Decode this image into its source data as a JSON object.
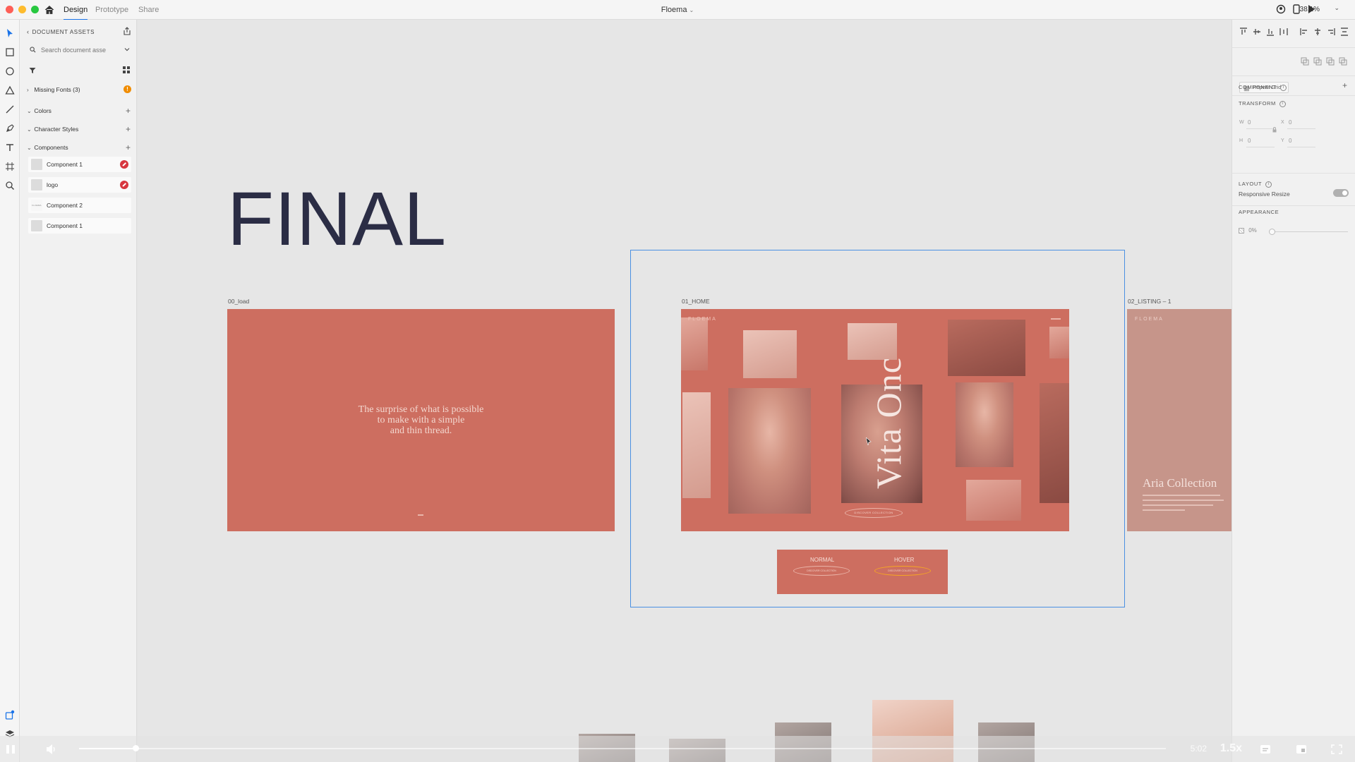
{
  "titlebar": {
    "tabs": [
      "Design",
      "Prototype",
      "Share"
    ],
    "document_title": "Floema",
    "zoom": "38,1%"
  },
  "assets_panel": {
    "header": "DOCUMENT ASSETS",
    "search_placeholder": "Search document asse",
    "sections": {
      "missing_fonts": "Missing Fonts (3)",
      "missing_fonts_badge": "!",
      "colors": "Colors",
      "character_styles": "Character Styles",
      "components": "Components"
    },
    "components": [
      {
        "label": "Component 1",
        "error": true
      },
      {
        "label": "logo",
        "error": true
      },
      {
        "label": "Component 2",
        "error": false,
        "thumb_text": "FLOEMA"
      },
      {
        "label": "Component 1",
        "error": false
      }
    ]
  },
  "canvas": {
    "title": "FINAL",
    "artboards": {
      "load": {
        "label": "00_load",
        "quote_lines": [
          "The surprise of what is possible",
          "to make with a simple",
          "and thin thread."
        ]
      },
      "home": {
        "label": "01_HOME",
        "brand": "FLOEMA",
        "headline": "Vita Onc",
        "button": "DISCOVER COLLECTION"
      },
      "listing": {
        "label": "02_LISTING – 1",
        "brand": "FLOEMA",
        "collection": "Aria Collection"
      }
    },
    "button_states": {
      "normal": "NORMAL",
      "hover": "HOVER",
      "button_text": "DISCOVER COLLECTION"
    }
  },
  "inspector": {
    "repeat_grid": "Repeat Grid",
    "component": "COMPONENT",
    "transform": "TRANSFORM",
    "w_label": "W",
    "w_value": "0",
    "x_label": "X",
    "x_value": "0",
    "h_label": "H",
    "h_value": "0",
    "y_label": "Y",
    "y_value": "0",
    "layout": "LAYOUT",
    "responsive_resize": "Responsive Resize",
    "appearance": "APPEARANCE",
    "opacity": "0%"
  },
  "video": {
    "time": "5:02",
    "speed": "1.5x"
  }
}
